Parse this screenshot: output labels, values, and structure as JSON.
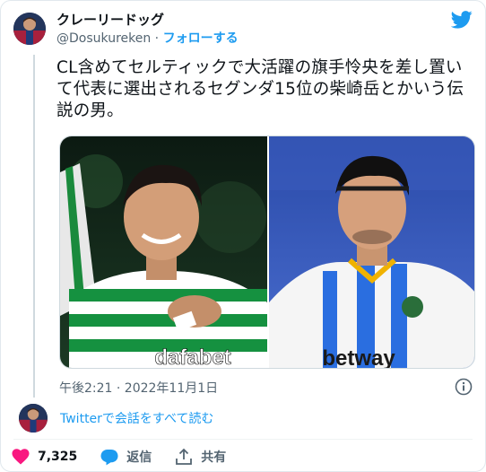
{
  "tweet": {
    "author_name": "クレーリードッグ",
    "handle": "@Dosukureken",
    "separator": " · ",
    "follow_label": "フォローする",
    "text": "CL含めてセルティックで大活躍の旗手怜央を差し置いて代表に選出されるセグンダ15位の柴崎岳とかいう伝説の男。",
    "timestamp": "午後2:21 · 2022年11月1日",
    "images": [
      {
        "shirt_text": "dafabet"
      },
      {
        "shirt_text": "betway"
      }
    ]
  },
  "conversation": {
    "read_label": "Twitterで会話をすべて読む"
  },
  "actions": {
    "like_count": "7,325",
    "reply_label": "返信",
    "share_label": "共有"
  },
  "colors": {
    "accent": "#1d9bf0",
    "like": "#f91880",
    "text": "#0f1419",
    "muted": "#536471"
  },
  "icons": [
    "twitter-bird-icon",
    "info-icon",
    "heart-icon",
    "reply-bubble-icon",
    "share-icon"
  ]
}
